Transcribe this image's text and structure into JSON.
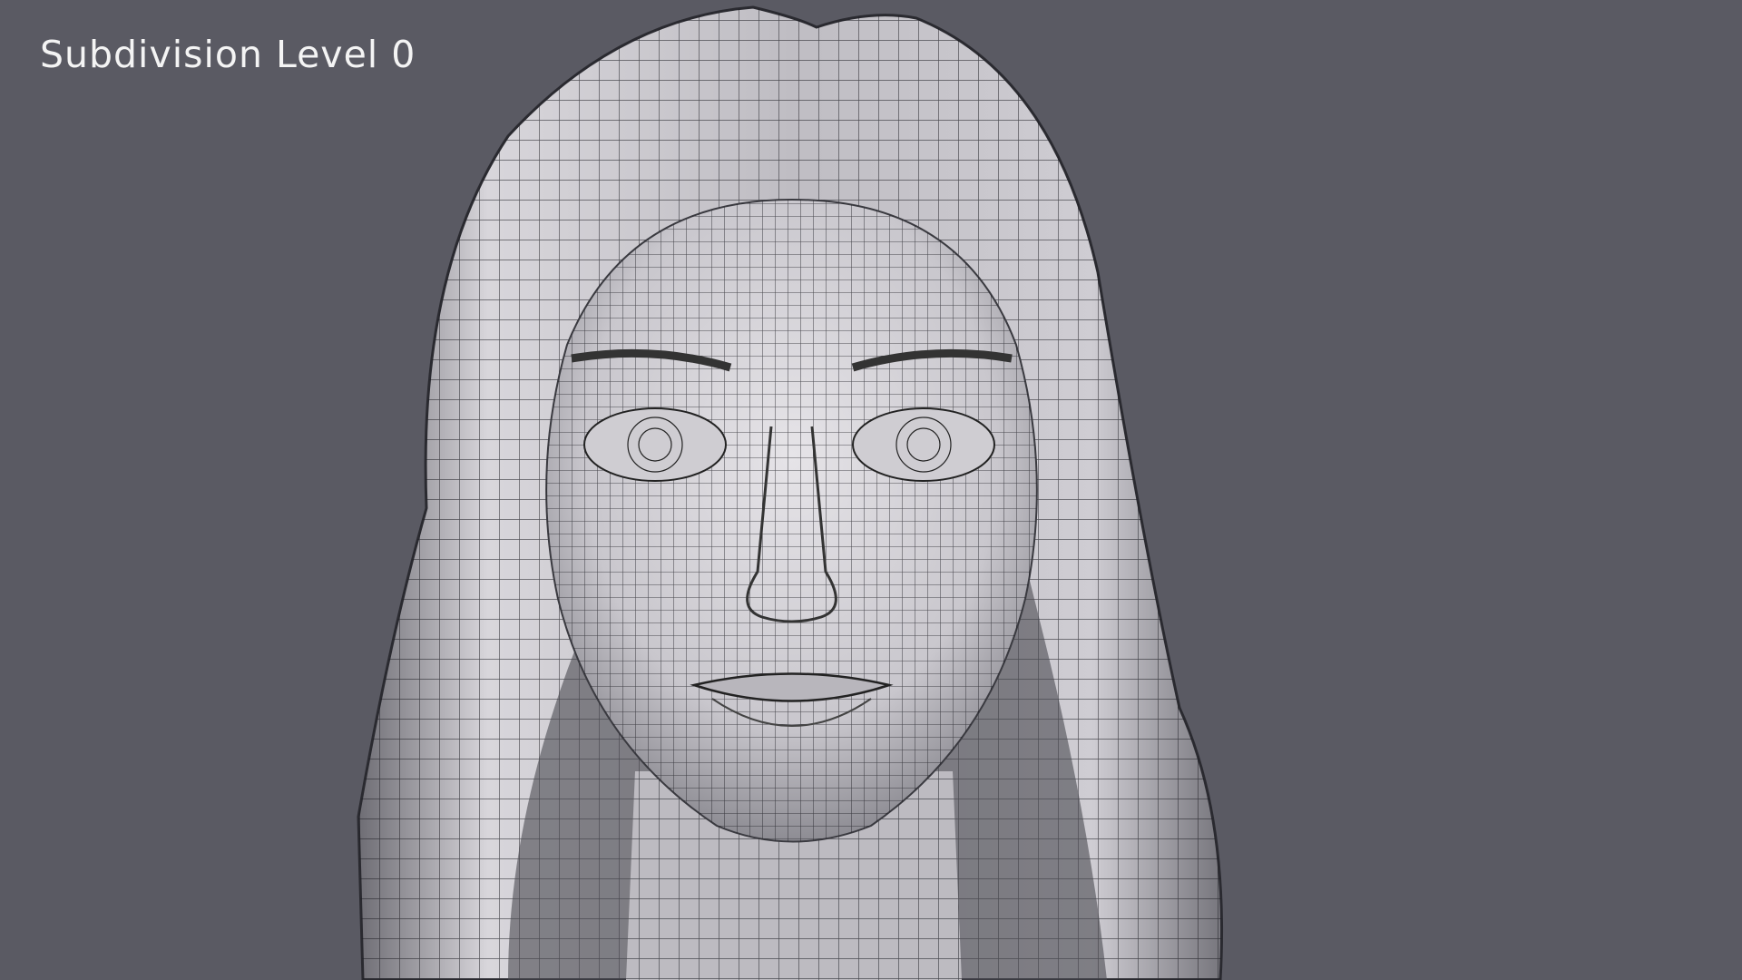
{
  "overlay": {
    "title": "Subdivision Level 0"
  },
  "colors": {
    "background": "#5a5a63",
    "mesh_surface": "#d9d7dc",
    "wire": "#1c1c22",
    "text": "#f4f4f4"
  }
}
